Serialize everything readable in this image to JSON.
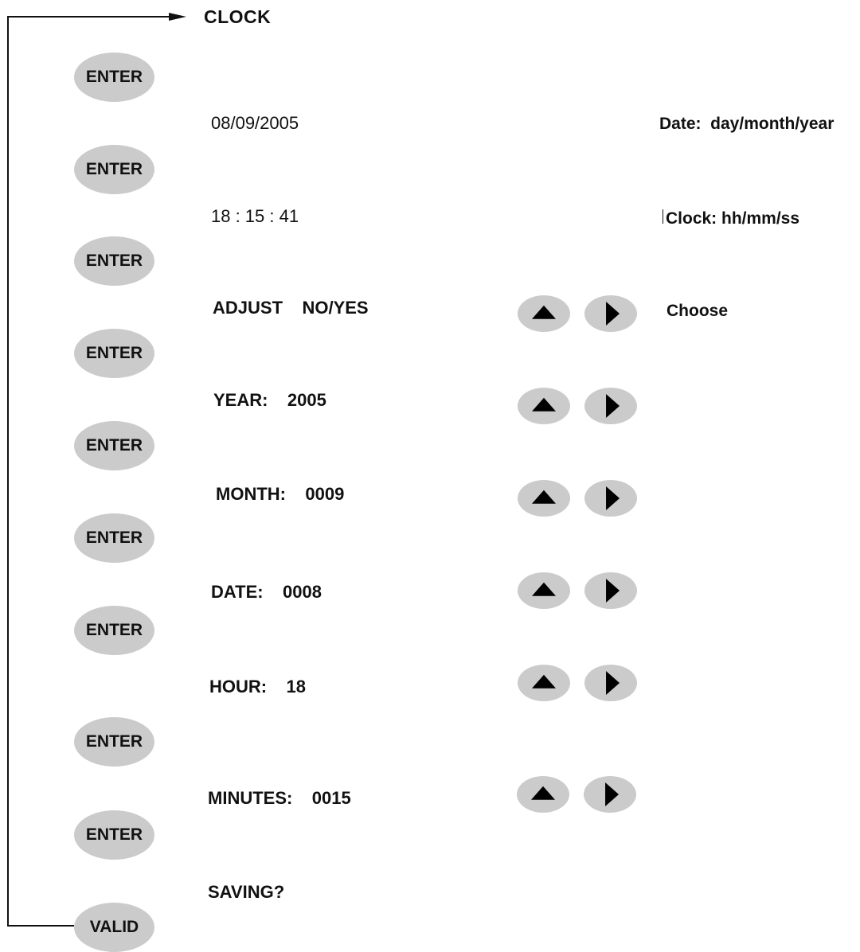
{
  "title": "CLOCK",
  "buttons": {
    "enter_label": "ENTER",
    "valid_label": "VALID"
  },
  "steps": {
    "date_value": "08/09/2005",
    "time_value": "18 : 15 : 41",
    "adjust": "ADJUST    NO/YES",
    "year": "YEAR:    2005",
    "month": "MONTH:    0009",
    "date": "DATE:    0008",
    "hour": "HOUR:    18",
    "minutes": "MINUTES:    0015",
    "saving": "SAVING?"
  },
  "notes": {
    "date_format": "Date:  day/month/year",
    "clock_format": "Clock: hh/mm/ss",
    "choose": "Choose"
  },
  "icons": {
    "up": "triangle-up-icon",
    "right": "triangle-right-icon"
  },
  "colors": {
    "button_fill": "#cbcbcb",
    "line": "#111111"
  }
}
